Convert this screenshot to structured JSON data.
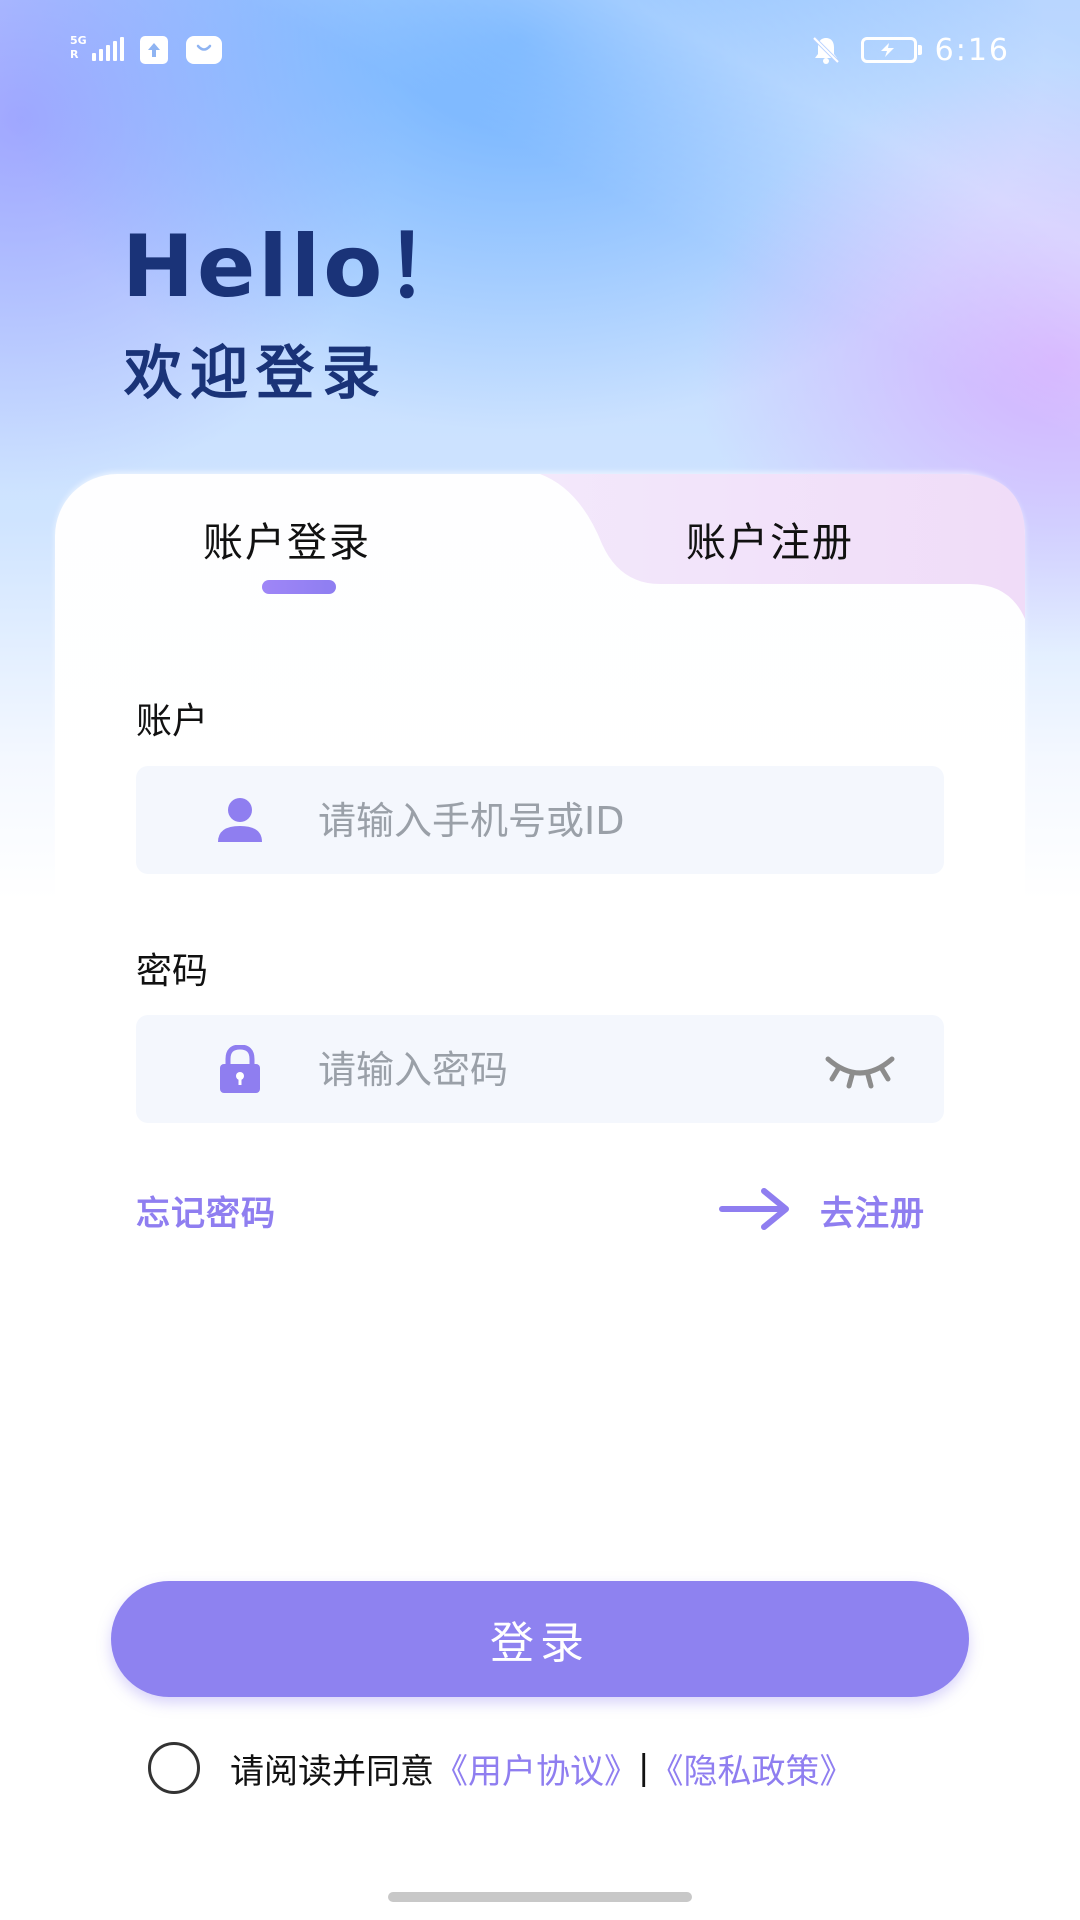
{
  "status_bar": {
    "network_label": "5G",
    "network_sub": "R",
    "time": "6:16"
  },
  "header": {
    "hello": "Hello！",
    "welcome": "欢迎登录"
  },
  "tabs": [
    {
      "label": "账户登录",
      "active": true
    },
    {
      "label": "账户注册",
      "active": false
    }
  ],
  "form": {
    "account_label": "账户",
    "account_placeholder": "请输入手机号或ID",
    "password_label": "密码",
    "password_placeholder": "请输入密码"
  },
  "links": {
    "forgot_password": "忘记密码",
    "go_register": "去注册"
  },
  "login_button": "登录",
  "agreement": {
    "prefix": "请阅读并同意",
    "user_agreement": "《用户协议》",
    "separator": "|",
    "privacy_policy": "《隐私政策》"
  },
  "colors": {
    "accent": "#8e82f0",
    "title": "#1a3378",
    "link": "#8f7ef0"
  }
}
